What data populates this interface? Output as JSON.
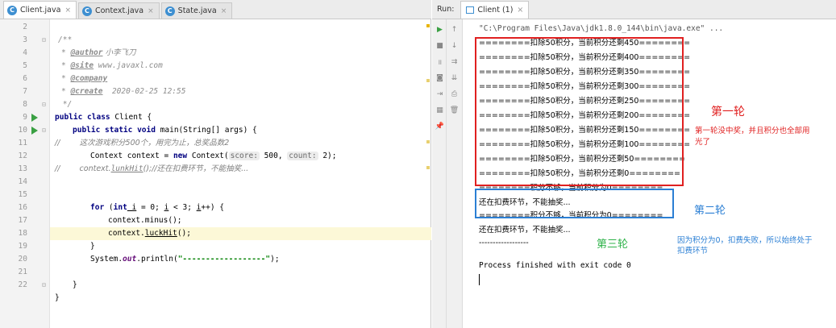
{
  "editor": {
    "tabs": [
      {
        "label": "Client.java",
        "active": true
      },
      {
        "label": "Context.java",
        "active": false
      },
      {
        "label": "State.java",
        "active": false
      }
    ],
    "tab_icon_letter": "C",
    "close_glyph": "×",
    "line_numbers": [
      "2",
      "3",
      "4",
      "5",
      "6",
      "7",
      "8",
      "9",
      "10",
      "11",
      "12",
      "13",
      "14",
      "15",
      "16",
      "17",
      "18",
      "19",
      "20",
      "21",
      "22"
    ],
    "code": {
      "l3": "/**",
      "l4_tag": "@author",
      "l4_val": " 小李飞刀",
      "l5_tag": "@site",
      "l5_val": " www.javaxl.com",
      "l6_tag": "@company",
      "l7_tag": "@create",
      "l7_val": "  2020-02-25 12:55",
      "l8": " */",
      "l9_kw": "public class",
      "l9_rest": " Client {",
      "l10_kw": "public static void",
      "l10_rest": " main(String[] args) {",
      "l11_cmt": "//        这次游戏积分500个，用完为止，总奖品数2",
      "l12_a": "Context context = ",
      "l12_kw": "new",
      "l12_b": " Context(",
      "l12_hint1": "score:",
      "l12_v1": " 500,",
      "l12_hint2": "count:",
      "l12_v2": " 2);",
      "l13_cmt_a": "//        context.",
      "l13_cmt_u": "lunkHit",
      "l13_cmt_b": "();//还在扣费环节，不能抽奖...",
      "l15_kw": "for",
      "l15_a": " (",
      "l15_kw2": "int",
      "l15_i1": " i",
      "l15_b": " = 0; ",
      "l15_i2": "i",
      "l15_c": " < 3; ",
      "l15_i3": "i",
      "l15_d": "++) {",
      "l16": "context.minus();",
      "l17_a": "context.",
      "l17_u": "luckHit",
      "l17_b": "();",
      "l18": "}",
      "l19_a": "System.",
      "l19_fld": "out",
      "l19_b": ".println(",
      "l19_str": "\"------------------\"",
      "l19_c": ");",
      "l21": "}",
      "l22": "}"
    }
  },
  "run": {
    "label": "Run:",
    "tab_label": "Client (1)",
    "close_glyph": "×",
    "toolbar_glyphs": {
      "play": "▶",
      "up": "↑",
      "stop": "■",
      "down": "↓",
      "pause": "॥",
      "wrap": "⇉",
      "camera": "◙",
      "sort": "⇊",
      "exit": "⇥",
      "print": "⎙",
      "layout": "▦",
      "trash": "🗑",
      "pin": "📌"
    },
    "console": {
      "path": "\"C:\\Program Files\\Java\\jdk1.8.0_144\\bin\\java.exe\" ...",
      "lines": [
        "========扣除50积分，当前积分还剩450========",
        "========扣除50积分，当前积分还剩400========",
        "========扣除50积分，当前积分还剩350========",
        "========扣除50积分，当前积分还剩300========",
        "========扣除50积分，当前积分还剩250========",
        "========扣除50积分，当前积分还剩200========",
        "========扣除50积分，当前积分还剩150========",
        "========扣除50积分，当前积分还剩100========",
        "========扣除50积分，当前积分还剩50========",
        "========扣除50积分，当前积分还剩0========",
        "========积分不够，当前积分为0========",
        "还在扣费环节，不能抽奖...",
        "========积分不够，当前积分为0========",
        "还在扣费环节，不能抽奖...",
        "------------------"
      ],
      "exit": "Process finished with exit code 0"
    }
  },
  "annotations": {
    "round1": "第一轮",
    "round1_note": "第一轮没中奖，并且积分也全部用光了",
    "round2": "第二轮",
    "round3": "第三轮",
    "round3_note": "因为积分为0，扣费失败，所以始终处于扣费环节"
  },
  "colors": {
    "red": "#e02020",
    "blue": "#2b7fd4",
    "green": "#2fb34a"
  }
}
